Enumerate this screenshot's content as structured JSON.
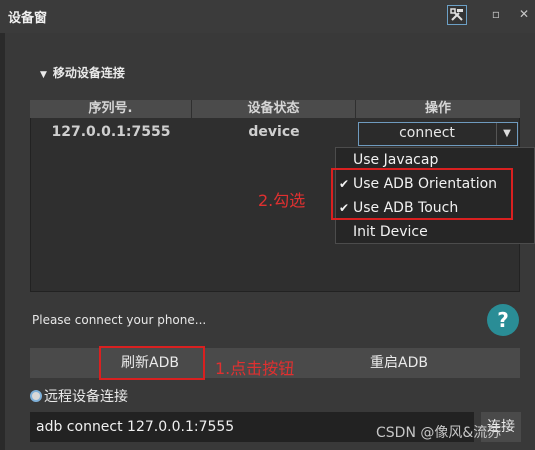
{
  "window": {
    "title": "设备窗"
  },
  "section": {
    "header": "移动设备连接"
  },
  "table": {
    "columns": [
      "序列号.",
      "设备状态",
      "操作"
    ],
    "row": {
      "serial": "127.0.0.1:7555",
      "status": "device",
      "action": "connect"
    }
  },
  "menu": {
    "items": [
      {
        "label": "Use Javacap",
        "checked": false
      },
      {
        "label": "Use ADB Orientation",
        "checked": true
      },
      {
        "label": "Use ADB Touch",
        "checked": true
      },
      {
        "label": "Init Device",
        "checked": false
      }
    ],
    "check_glyph": "✔"
  },
  "annotations": {
    "step1": "1.点击按钮",
    "step2": "2.勾选",
    "color": "#d92020"
  },
  "status_text": "Please connect your phone...",
  "help_label": "?",
  "buttons": {
    "refresh_adb": "刷新ADB",
    "restart_adb": "重启ADB"
  },
  "remote": {
    "label": "远程设备连接",
    "input_value": "adb connect 127.0.0.1:7555",
    "connect_button": "连接"
  },
  "watermark": "CSDN @像风&流苏",
  "icons": {
    "tools": "tools-icon",
    "restore": "restore-icon",
    "close": "close-icon",
    "collapse": "triangle-down-icon",
    "dropdown": "chevron-down-icon"
  },
  "colors": {
    "background": "#393939",
    "accent": "#6f9bbf",
    "help": "#2a8d96"
  }
}
